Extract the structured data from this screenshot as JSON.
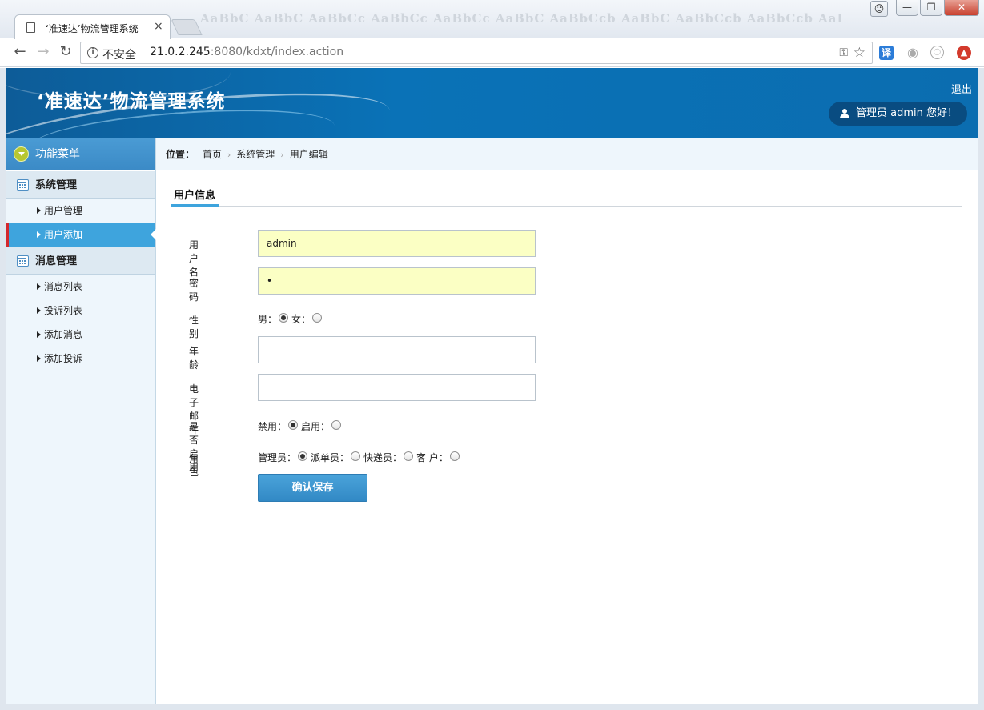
{
  "browser": {
    "tab_title": "‘准速达’物流管理系统",
    "tab_close": "×",
    "insecure_label": "不安全",
    "url_host": "21.0.2.245",
    "url_rest": ":8080/kdxt/index.action",
    "deco_text": "AaBbC  AaBbC  AaBbCc  AaBbCc  AaBbCc  AaBbC  AaBbCcb  AaBbC  AaBbCcb  AaBbCcb  AaBbCc",
    "translate_label": "译",
    "window_buttons": [
      "—",
      "❐",
      "✕"
    ]
  },
  "header": {
    "title": "‘准速达’物流管理系统",
    "logout": "退出",
    "greeting": "管理员  admin 您好！"
  },
  "sidebar": {
    "title": "功能菜单",
    "groups": [
      {
        "label": "系统管理",
        "items": [
          "用户管理",
          "用户添加"
        ]
      },
      {
        "label": "消息管理",
        "items": [
          "消息列表",
          "投诉列表",
          "添加消息",
          "添加投诉"
        ]
      }
    ],
    "active_item": "用户添加"
  },
  "breadcrumb": {
    "label": "位置：",
    "items": [
      "首页",
      "系统管理",
      "用户编辑"
    ]
  },
  "tab": {
    "label": "用户信息"
  },
  "form": {
    "username": {
      "label": "用户名",
      "value": "admin"
    },
    "password": {
      "label": "密码",
      "value": "•"
    },
    "gender": {
      "label": "性别",
      "options": [
        "男：",
        "女："
      ],
      "selected": "男"
    },
    "age": {
      "label": "年龄",
      "value": ""
    },
    "email": {
      "label": "电子邮件",
      "value": ""
    },
    "enabled": {
      "label": "是否启用",
      "options": [
        "禁用：",
        "启用："
      ],
      "selected": "禁用"
    },
    "role": {
      "label": "角色",
      "options": [
        "管理员：",
        "派单员：",
        "快递员：",
        "客 户："
      ],
      "selected": "管理员"
    },
    "save_label": "确认保存"
  },
  "colors": {
    "header_blue": "#0a72b7",
    "active_item": "#3ea4dd",
    "active_marker": "#d4282e",
    "input_highlight": "#fbffc4"
  }
}
